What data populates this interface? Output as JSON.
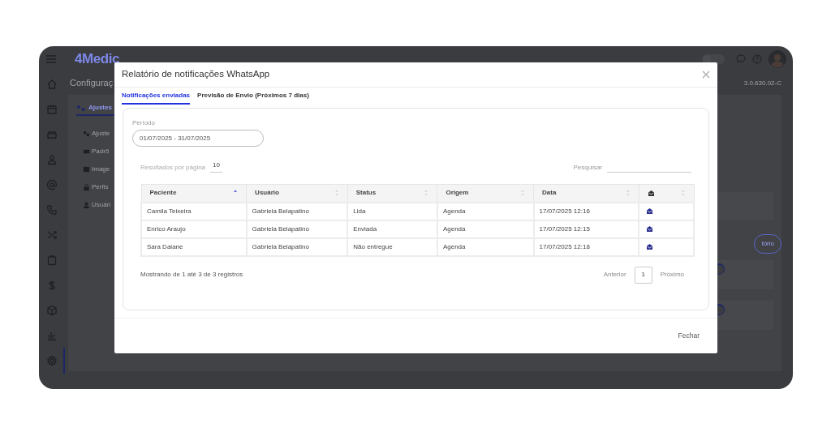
{
  "app": {
    "logo": "4Medic",
    "page_title": "Configuraç",
    "version": "3.0.630.02-C",
    "theme_toggle": {
      "on": false
    },
    "rail": [
      {
        "selected": false
      },
      {
        "selected": false
      },
      {
        "selected": false
      },
      {
        "selected": false
      },
      {
        "selected": false
      },
      {
        "selected": false
      },
      {
        "selected": false
      },
      {
        "selected": false
      },
      {
        "selected": false
      },
      {
        "selected": false
      },
      {
        "selected": false
      },
      {
        "selected": true
      }
    ],
    "tab": "Ajustes",
    "menu": [
      "Ajuste",
      "Padrõ",
      "Image",
      "Perfis",
      "Usuári"
    ],
    "report_button": "tório",
    "toggles": [
      {
        "on": true
      },
      {
        "on": true
      }
    ]
  },
  "modal": {
    "title": "Relatório de notificações WhatsApp",
    "tabs": [
      {
        "label": "Notificações enviadas",
        "selected": true
      },
      {
        "label": "Previsão de Envio (Próximos 7 dias)",
        "selected": false
      }
    ],
    "period": {
      "label": "Período",
      "value": "01/07/2025 - 31/07/2025"
    },
    "page_size": {
      "label": "Resultados por página",
      "value": "10"
    },
    "search": {
      "label": "Pesquisar"
    },
    "table": {
      "columns": [
        {
          "kind": "text",
          "label": "Paciente",
          "sorted": true
        },
        {
          "kind": "text",
          "label": "Usuário",
          "sorted": false
        },
        {
          "kind": "text",
          "label": "Status",
          "sorted": false
        },
        {
          "kind": "text",
          "label": "Origem",
          "sorted": false
        },
        {
          "kind": "text",
          "label": "Data",
          "sorted": false
        },
        {
          "kind": "icon",
          "sorted": false
        }
      ],
      "rows": [
        {
          "cells": [
            "Camila Teixeira",
            "Gabriela Belapatino",
            "Lida",
            "Agenda",
            "17/07/2025 12:16"
          ]
        },
        {
          "cells": [
            "Enrico Araujo",
            "Gabriela Belapatino",
            "Enviada",
            "Agenda",
            "17/07/2025 12:15"
          ]
        },
        {
          "cells": [
            "Sara Daiane",
            "Gabriela Belapatino",
            "Não entregue",
            "Agenda",
            "17/07/2025 12:18"
          ]
        }
      ]
    },
    "summary": "Mostrando de 1 até 3 de 3 registros",
    "pagination": {
      "previous": "Anterior",
      "page": "1",
      "next": "Próximo"
    },
    "close_button": "Fechar"
  }
}
